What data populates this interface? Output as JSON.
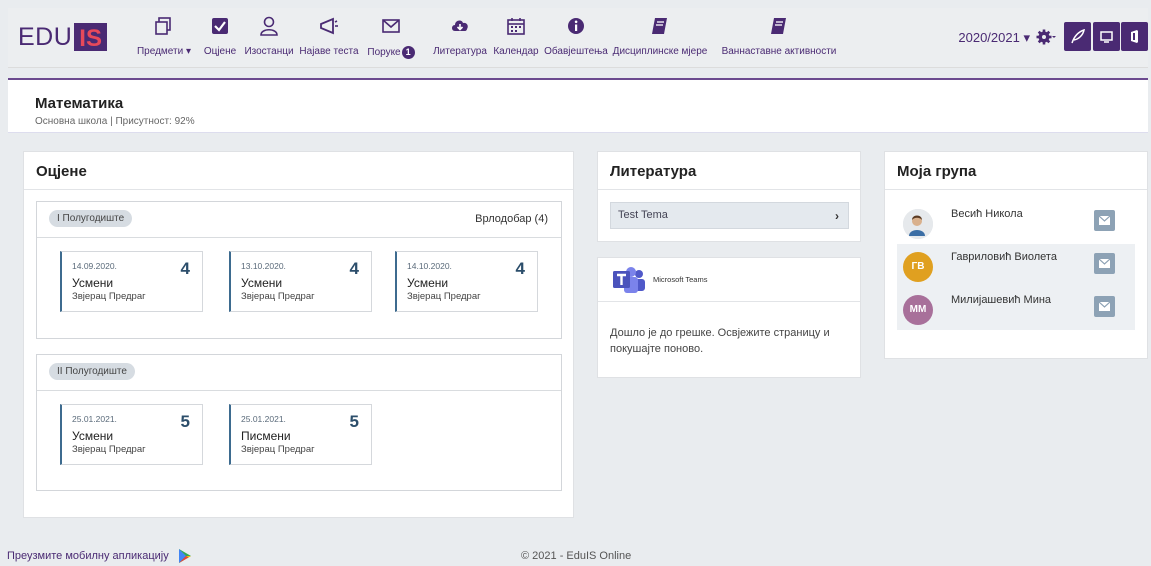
{
  "app": {
    "logo_text": "EDU",
    "logo_box": "IS",
    "brand_color": "#4a2a73"
  },
  "nav": {
    "items": [
      {
        "label": "Предмети",
        "icon": "subjects-icon",
        "has_dropdown": true
      },
      {
        "label": "Оцјене",
        "icon": "checkbox-icon"
      },
      {
        "label": "Изостанци",
        "icon": "user-outline-icon"
      },
      {
        "label": "Најаве теста",
        "icon": "megaphone-icon"
      },
      {
        "label": "Поруке",
        "icon": "envelope-icon",
        "badge": "1"
      },
      {
        "label": "Литература",
        "icon": "cloud-download-icon"
      },
      {
        "label": "Календар",
        "icon": "calendar-icon"
      },
      {
        "label": "Обавјештења",
        "icon": "info-icon"
      },
      {
        "label": "Дисциплинске мјере",
        "icon": "book-icon"
      },
      {
        "label": "Ваннаставне активности",
        "icon": "book-icon"
      }
    ]
  },
  "toolbar": {
    "school_year": "2020/2021",
    "settings_icon": "gear-icon",
    "buttons": [
      "feather-icon",
      "book-open-icon",
      "office-icon"
    ]
  },
  "subject": {
    "title": "Математика",
    "subtitle": "Основна школа | Присутност: 92%"
  },
  "grades_panel": {
    "title": "Оцјене",
    "terms": [
      {
        "label": "I Полугодиште",
        "summary": "Врлодобар (4)",
        "grades": [
          {
            "date": "14.09.2020.",
            "value": "4",
            "type": "Усмени",
            "teacher": "Звјерац Предраг"
          },
          {
            "date": "13.10.2020.",
            "value": "4",
            "type": "Усмени",
            "teacher": "Звјерац Предраг"
          },
          {
            "date": "14.10.2020.",
            "value": "4",
            "type": "Усмени",
            "teacher": "Звјерац Предраг"
          }
        ]
      },
      {
        "label": "II Полугодиште",
        "summary": "",
        "grades": [
          {
            "date": "25.01.2021.",
            "value": "5",
            "type": "Усмени",
            "teacher": "Звјерац Предраг"
          },
          {
            "date": "25.01.2021.",
            "value": "5",
            "type": "Писмени",
            "teacher": "Звјерац Предраг"
          }
        ]
      }
    ]
  },
  "literature_panel": {
    "title": "Литература",
    "items": [
      {
        "label": "Test Tema"
      }
    ]
  },
  "teams_panel": {
    "label": "Microsoft Teams",
    "message": "Дошло је до грешке. Освјежите страницу и покушајте поново."
  },
  "group_panel": {
    "title": "Моја група",
    "members": [
      {
        "name": "Весић Никола",
        "initials": "",
        "color": "#d8dde2"
      },
      {
        "name": "Гавриловић Виолета",
        "initials": "ГВ",
        "color": "#e0a020"
      },
      {
        "name": "Милијашевић Мина",
        "initials": "ММ",
        "color": "#a8709a"
      }
    ]
  },
  "footer": {
    "app_link": "Преузмите мобилну апликацију",
    "copyright": "© 2021 - EduIS Online"
  }
}
